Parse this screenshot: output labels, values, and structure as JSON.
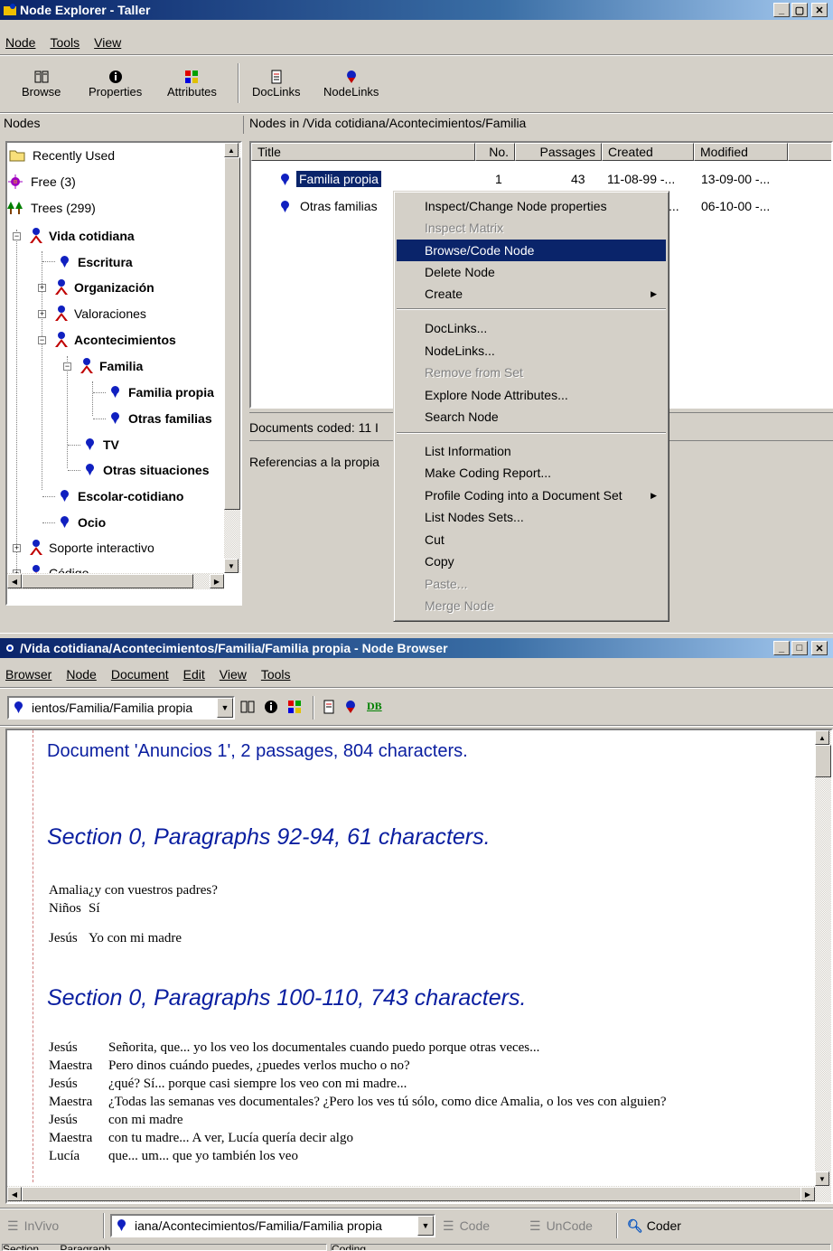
{
  "explorer": {
    "title": "Node Explorer - Taller",
    "menu": [
      "Node",
      "Tools",
      "View"
    ],
    "toolbar": {
      "browse": "Browse",
      "properties": "Properties",
      "attributes": "Attributes",
      "doclinks": "DocLinks",
      "nodelinks": "NodeLinks"
    },
    "nodes_header": "Nodes",
    "path_header": "Nodes in /Vida cotidiana/Acontecimientos/Familia",
    "tree": [
      {
        "label": "Recently Used",
        "icon": "folder-icon",
        "bold": false
      },
      {
        "label": "Free (3)",
        "icon": "star-icon",
        "bold": false
      },
      {
        "label": "Trees (299)",
        "icon": "trees-icon",
        "bold": false
      },
      {
        "label": "Vida cotidiana",
        "bold": true
      },
      {
        "label": "Escritura",
        "bold": true
      },
      {
        "label": "Organización",
        "bold": true
      },
      {
        "label": "Valoraciones",
        "bold": false
      },
      {
        "label": "Acontecimientos",
        "bold": true
      },
      {
        "label": "Familia",
        "bold": true
      },
      {
        "label": "Familia propia",
        "bold": true
      },
      {
        "label": "Otras familias",
        "bold": true
      },
      {
        "label": "TV",
        "bold": true
      },
      {
        "label": "Otras situaciones",
        "bold": true
      },
      {
        "label": "Escolar-cotidiano",
        "bold": true
      },
      {
        "label": "Ocio",
        "bold": true
      },
      {
        "label": "Soporte interactivo",
        "bold": false
      },
      {
        "label": "Código",
        "bold": false
      }
    ],
    "columns": [
      "Title",
      "No.",
      "Passages",
      "Created",
      "Modified"
    ],
    "rows": [
      {
        "title": "Familia propia",
        "no": "1",
        "passages": "43",
        "created": "11-08-99 -...",
        "modified": "13-09-00 -..."
      },
      {
        "title": "Otras familias",
        "no": "",
        "passages": "",
        "created": "...",
        "modified": "06-10-00 -..."
      }
    ],
    "docs_coded": "Documents coded: 11 I",
    "description": "Referencias a la propia"
  },
  "context_menu": [
    {
      "label": "Inspect/Change Node properties",
      "state": "normal"
    },
    {
      "label": "Inspect Matrix",
      "state": "disabled"
    },
    {
      "label": "Browse/Code Node",
      "state": "selected"
    },
    {
      "label": "Delete Node",
      "state": "normal"
    },
    {
      "label": "Create",
      "state": "normal",
      "submenu": true
    },
    {
      "label": "DocLinks...",
      "state": "normal"
    },
    {
      "label": "NodeLinks...",
      "state": "normal"
    },
    {
      "label": "Remove from Set",
      "state": "disabled"
    },
    {
      "label": "Explore Node Attributes...",
      "state": "normal"
    },
    {
      "label": "Search Node",
      "state": "normal"
    },
    {
      "label": "List Information",
      "state": "normal"
    },
    {
      "label": "Make Coding Report...",
      "state": "normal"
    },
    {
      "label": "Profile Coding into a Document Set",
      "state": "normal",
      "submenu": true
    },
    {
      "label": "List Nodes Sets...",
      "state": "normal"
    },
    {
      "label": "Cut",
      "state": "normal"
    },
    {
      "label": "Copy",
      "state": "normal"
    },
    {
      "label": "Paste...",
      "state": "disabled"
    },
    {
      "label": "Merge Node",
      "state": "disabled"
    }
  ],
  "browser": {
    "title": "/Vida cotidiana/Acontecimientos/Familia/Familia propia - Node Browser",
    "menu": [
      "Browser",
      "Node",
      "Document",
      "Edit",
      "View",
      "Tools"
    ],
    "node_combo": "ientos/Familia/Familia propia",
    "db_label": "DB",
    "doc_heading": "Document 'Anuncios 1', 2 passages, 804 characters.",
    "section1": "Section 0, Paragraphs 92-94, 61 characters.",
    "section1_lines": [
      {
        "speaker": "Amalia",
        "text": "¿y con vuestros padres?"
      },
      {
        "speaker": "Niños",
        "text": "Sí"
      },
      {
        "speaker": "Jesús",
        "text": "Yo con mi madre"
      }
    ],
    "section2": "Section 0, Paragraphs 100-110, 743 characters.",
    "section2_lines": [
      {
        "speaker": "Jesús",
        "text": "Señorita, que... yo los veo los documentales cuando puedo porque otras veces..."
      },
      {
        "speaker": "Maestra",
        "text": "Pero dinos cuándo puedes, ¿puedes verlos mucho o no?"
      },
      {
        "speaker": "Jesús",
        "text": "¿qué? Sí... porque casi siempre los veo con mi madre..."
      },
      {
        "speaker": "Maestra",
        "text": "¿Todas las semanas ves documentales? ¿Pero los ves tú sólo, como dice Amalia, o los ves con alguien?"
      },
      {
        "speaker": "Jesús",
        "text": "con mi madre"
      },
      {
        "speaker": "Maestra",
        "text": "con tu madre... A ver, Lucía quería decir algo"
      },
      {
        "speaker": "Lucía",
        "text": "que... um... que yo también los veo"
      }
    ],
    "bottom": {
      "invivo": "InVivo",
      "combo": "iana/Acontecimientos/Familia/Familia propia",
      "code": "Code",
      "uncode": "UnCode",
      "coder": "Coder"
    },
    "status": [
      "Section.......Paragraph.............",
      "Coding......"
    ]
  }
}
